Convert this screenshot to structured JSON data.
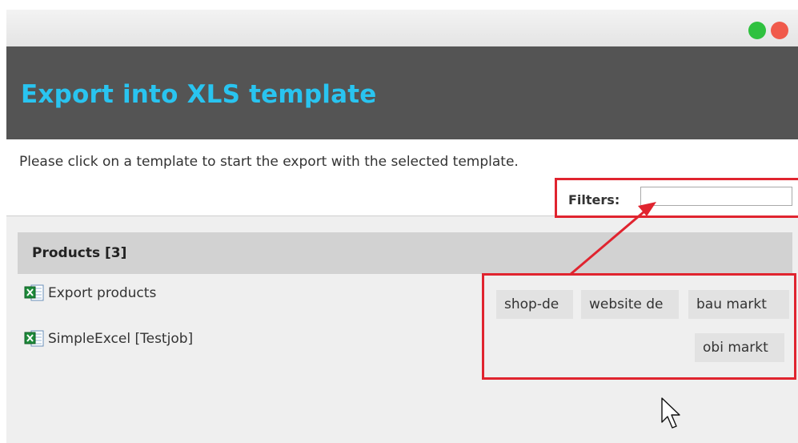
{
  "dialog": {
    "title": "Export into XLS template",
    "instruction": "Please click on a template to start the export with the selected template.",
    "title_color": "#29c4f0",
    "banner_color": "#545454"
  },
  "window_controls": {
    "green": "#2fc13f",
    "red": "#f05a4b"
  },
  "filters": {
    "label": "Filters:",
    "value": ""
  },
  "group": {
    "header": "Products [3]",
    "templates": [
      {
        "label": "Export products",
        "icon": "excel-file-icon"
      },
      {
        "label": "SimpleExcel [Testjob]",
        "icon": "excel-file-icon"
      }
    ]
  },
  "tags": [
    "shop-de",
    "website de",
    "bau markt",
    "obi markt"
  ],
  "annotation": {
    "highlight_color": "#e0242f"
  },
  "cursor": {
    "icon": "mouse-pointer-icon"
  }
}
